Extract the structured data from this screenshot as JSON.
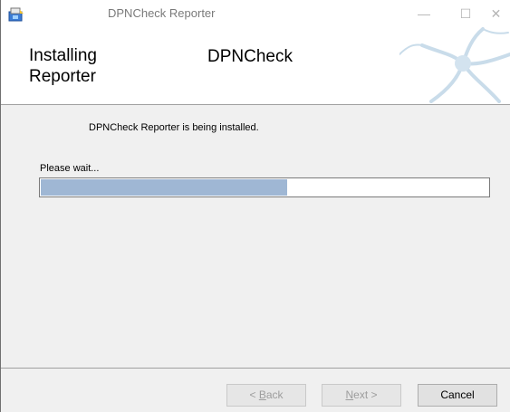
{
  "window": {
    "title": "DPNCheck Reporter",
    "controls": {
      "minimize": "—",
      "maximize": "☐",
      "close": "✕"
    }
  },
  "banner": {
    "title": "Installing Reporter",
    "product": "DPNCheck"
  },
  "content": {
    "status": "DPNCheck Reporter is being installed.",
    "wait_label": "Please wait...",
    "progress": 0.55
  },
  "footer": {
    "back_label": "< Back",
    "back_accel": "B",
    "next_label": "Next >",
    "next_accel": "N",
    "cancel_label": "Cancel"
  },
  "colors": {
    "progress_fill": "#9fb7d4",
    "dialog_bg": "#f0f0f0"
  },
  "icons": [
    "installer-app-icon",
    "neuron-banner-graphic"
  ]
}
